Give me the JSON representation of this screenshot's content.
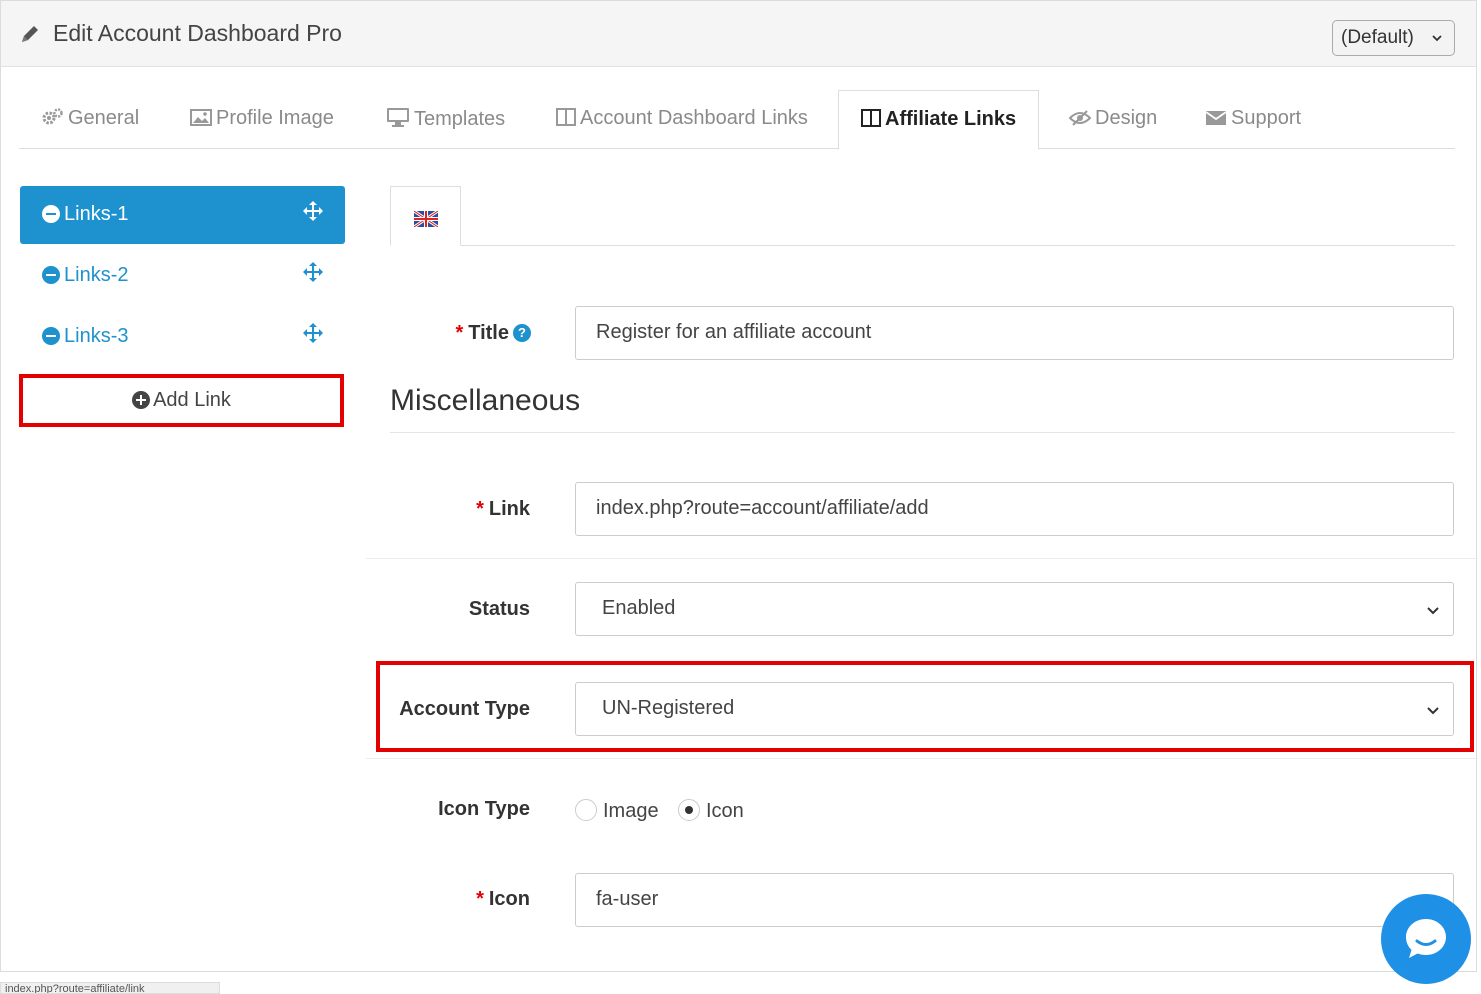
{
  "header": {
    "title": "Edit Account Dashboard Pro",
    "store_select": "(Default)"
  },
  "tabs": [
    {
      "label": "General",
      "icon": "cogs-icon"
    },
    {
      "label": "Profile Image",
      "icon": "image-icon"
    },
    {
      "label": "Templates",
      "icon": "desktop-icon"
    },
    {
      "label": "Account Dashboard Links",
      "icon": "columns-icon"
    },
    {
      "label": "Affiliate Links",
      "icon": "columns-icon",
      "active": true
    },
    {
      "label": "Design",
      "icon": "eye-slash-icon"
    },
    {
      "label": "Support",
      "icon": "envelope-icon"
    }
  ],
  "sidebar": {
    "items": [
      {
        "label": "Links-1",
        "active": true
      },
      {
        "label": "Links-2"
      },
      {
        "label": "Links-3"
      }
    ],
    "add_link": "Add Link"
  },
  "form": {
    "title_label": "Title",
    "title_value": "Register for an affiliate account",
    "section_heading": "Miscellaneous",
    "link_label": "Link",
    "link_value": "index.php?route=account/affiliate/add",
    "status_label": "Status",
    "status_value": "Enabled",
    "account_type_label": "Account Type",
    "account_type_value": "UN-Registered",
    "icon_type_label": "Icon Type",
    "icon_type_options": [
      "Image",
      "Icon"
    ],
    "icon_type_selected": "Icon",
    "icon_label": "Icon",
    "icon_value": "fa-user",
    "required_mark": "*",
    "help_mark": "?"
  },
  "status_bar": "index.php?route=affiliate/link",
  "colors": {
    "primary": "#1e91cf",
    "highlight": "#e30000",
    "chat": "#1e91e6"
  }
}
